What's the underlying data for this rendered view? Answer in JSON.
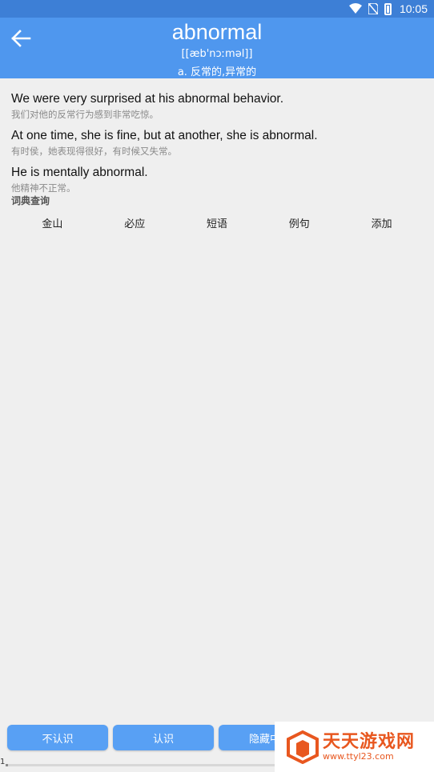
{
  "status_bar": {
    "time": "10:05"
  },
  "header": {
    "word": "abnormal",
    "phonetic": "[[æb'nɔːməl]]",
    "meaning": "a. 反常的,异常的"
  },
  "sentences": [
    {
      "en": "We were very surprised at his abnormal behavior.",
      "zh": "我们对他的反常行为感到非常吃惊。"
    },
    {
      "en": "At one time, she is fine, but at another, she is abnormal.",
      "zh": "有时侯，她表现得很好，有时候又失常。"
    },
    {
      "en": "He is mentally abnormal.",
      "zh": "他精神不正常。"
    }
  ],
  "dict_label": "词典查询",
  "tabs": [
    "金山",
    "必应",
    "短语",
    "例句",
    "添加"
  ],
  "buttons": {
    "unknown": "不认识",
    "known": "认识",
    "hide": "隐藏中"
  },
  "progress": {
    "label": "1",
    "fraction": 0.01
  },
  "watermark": {
    "title": "天天游戏网",
    "url": "www.ttyl23.com"
  },
  "colors": {
    "appbar": "#4f97ee",
    "statusbar": "#3d7fd6",
    "button": "#58a0f4",
    "watermark": "#e8571f"
  }
}
